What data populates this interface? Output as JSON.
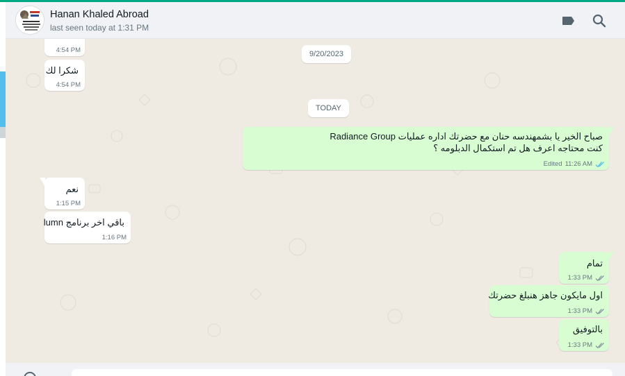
{
  "header": {
    "contact_name": "Hanan Khaled Abroad",
    "status": "last seen today at 1:31 PM",
    "icons": [
      "label-icon",
      "search-icon"
    ]
  },
  "colors": {
    "accent": "#00a884",
    "outgoing_bubble": "#d9fdd3",
    "incoming_bubble": "#ffffff",
    "chat_background": "#efeae2",
    "read_tick": "#53bdeb"
  },
  "chat": {
    "dates": {
      "first": "9/20/2023",
      "today": "TODAY"
    },
    "messages": [
      {
        "dir": "in",
        "text": "",
        "time": "4:54 PM"
      },
      {
        "dir": "in",
        "text": "شكرا لك",
        "time": "4:54 PM"
      },
      {
        "dir": "out",
        "line1": "صباح الخير يا بشمهندسه حنان مع حضرتك اداره عمليات Radiance Group",
        "line2": "كنت محتاجه اعرف هل تم استكمال الدبلومه ؟",
        "edited": "Edited",
        "time": "11:26 AM"
      },
      {
        "dir": "in",
        "text": "نعم",
        "time": "1:15 PM"
      },
      {
        "dir": "in",
        "text": "باقي اخر برنامج lumn",
        "time": "1:16 PM"
      },
      {
        "dir": "out",
        "text": "تمام",
        "time": "1:33 PM"
      },
      {
        "dir": "out",
        "text": "اول مايكون جاهز هنبلغ حضرتك",
        "time": "1:33 PM"
      },
      {
        "dir": "out",
        "text": "بالتوفيق",
        "time": "1:33 PM"
      }
    ]
  }
}
